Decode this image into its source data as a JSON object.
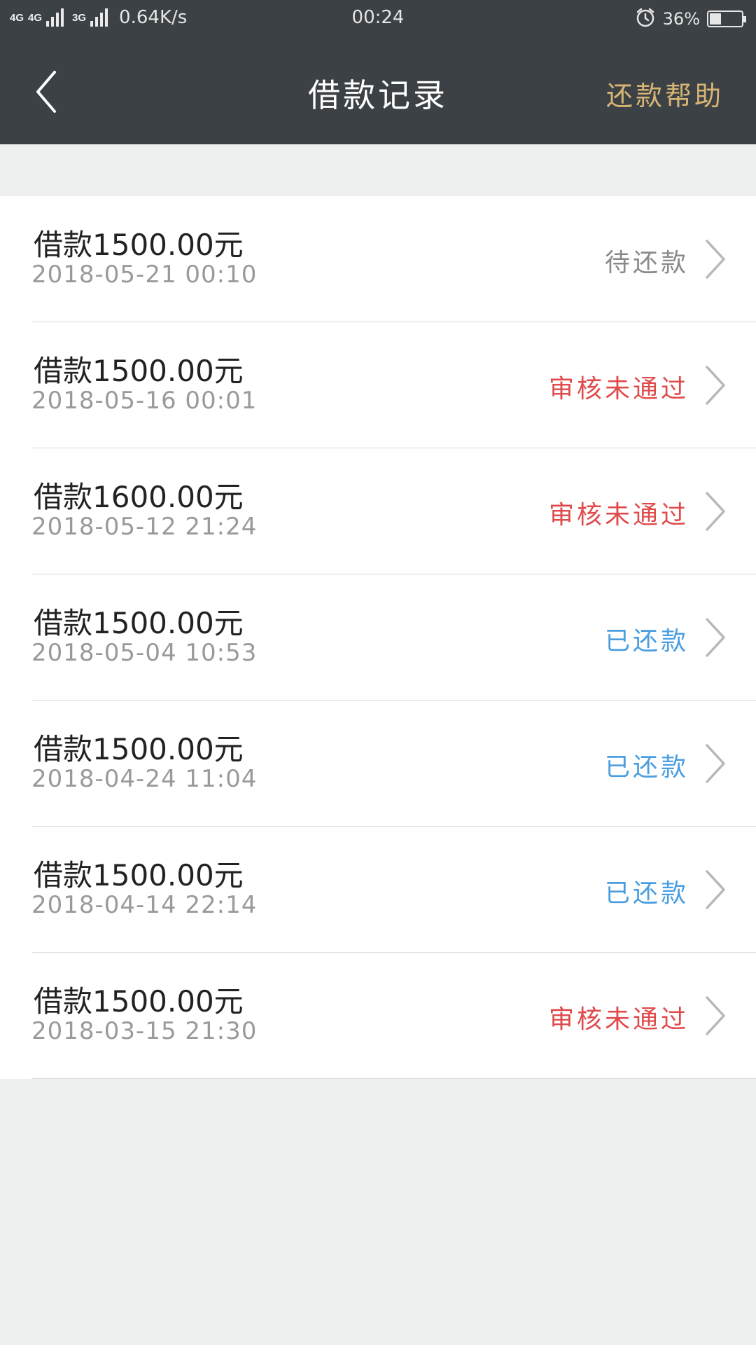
{
  "status_bar": {
    "net1": "4G",
    "net2": "4G",
    "net3": "3G",
    "speed": "0.64K/s",
    "time": "00:24",
    "battery": "36%",
    "battery_level": 0.36
  },
  "header": {
    "title": "借款记录",
    "help": "还款帮助"
  },
  "colors": {
    "pending": "#8a8a8a",
    "rejected": "#e04a4a",
    "repaid": "#4a9ee0",
    "help": "#d7b575"
  },
  "records": [
    {
      "title": "借款1500.00元",
      "date": "2018-05-21 00:10",
      "status": "待还款",
      "status_type": "pending"
    },
    {
      "title": "借款1500.00元",
      "date": "2018-05-16 00:01",
      "status": "审核未通过",
      "status_type": "rejected"
    },
    {
      "title": "借款1600.00元",
      "date": "2018-05-12 21:24",
      "status": "审核未通过",
      "status_type": "rejected"
    },
    {
      "title": "借款1500.00元",
      "date": "2018-05-04 10:53",
      "status": "已还款",
      "status_type": "repaid"
    },
    {
      "title": "借款1500.00元",
      "date": "2018-04-24 11:04",
      "status": "已还款",
      "status_type": "repaid"
    },
    {
      "title": "借款1500.00元",
      "date": "2018-04-14 22:14",
      "status": "已还款",
      "status_type": "repaid"
    },
    {
      "title": "借款1500.00元",
      "date": "2018-03-15 21:30",
      "status": "审核未通过",
      "status_type": "rejected"
    }
  ]
}
